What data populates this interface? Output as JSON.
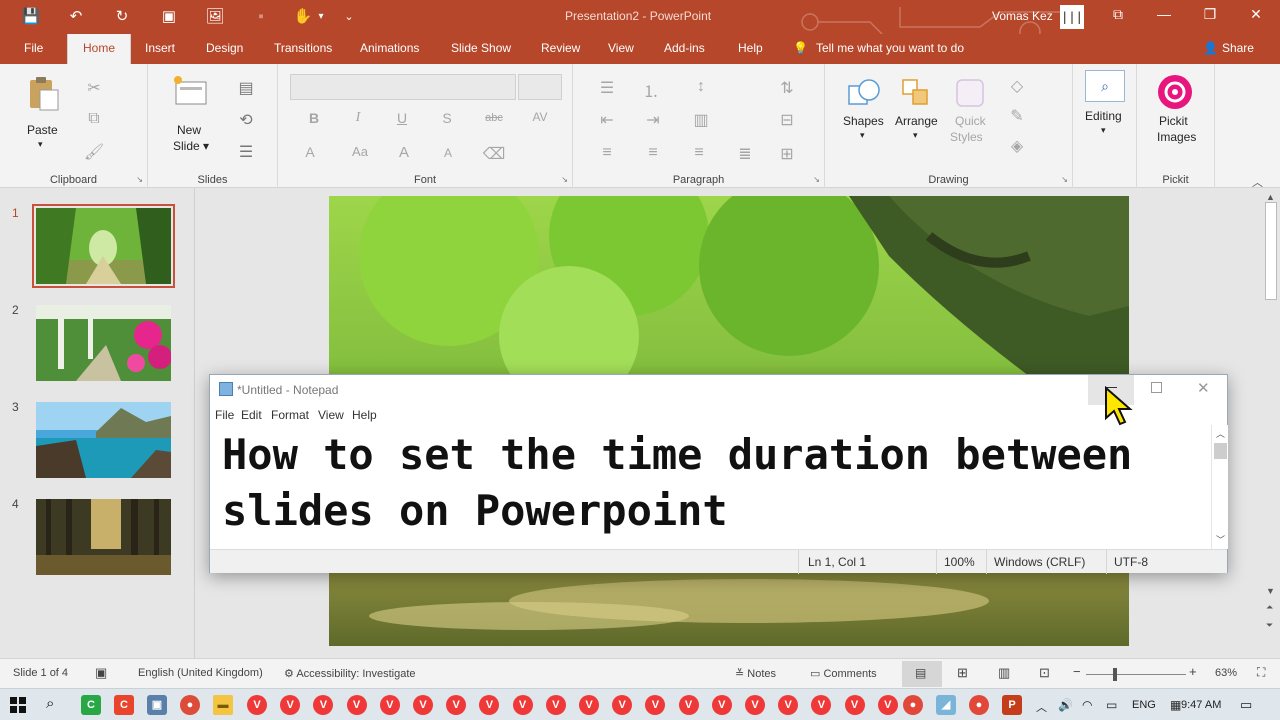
{
  "titlebar": {
    "qat": {
      "save": "💾",
      "undo": "↶",
      "redo": "↻",
      "present": "▣",
      "photo": "🖼",
      "format": "▪",
      "touch": "✋",
      "more": "⌄"
    },
    "title": "Presentation2  -  PowerPoint",
    "user": "Vomas Kez",
    "avatar_text": "|||",
    "window_controls": {
      "ribbon_options": "⧉",
      "minimize": "—",
      "maximize": "❐",
      "close": "✕"
    }
  },
  "tabs": [
    "File",
    "Home",
    "Insert",
    "Design",
    "Transitions",
    "Animations",
    "Slide Show",
    "Review",
    "View",
    "Add-ins",
    "Help"
  ],
  "active_tab": "Home",
  "tell_me": "Tell me what you want to do",
  "share": "Share",
  "ribbon": {
    "clipboard": {
      "label": "Clipboard",
      "paste": "Paste"
    },
    "slides": {
      "label": "Slides",
      "new_slide_1": "New",
      "new_slide_2": "Slide ▾"
    },
    "font": {
      "label": "Font",
      "bold": "B",
      "italic": "I",
      "underline": "U",
      "shadow": "S",
      "strike": "abc",
      "spacing": "AV",
      "color": "A",
      "case": "Aa",
      "grow": "A",
      "shrink": "A"
    },
    "paragraph": {
      "label": "Paragraph"
    },
    "drawing": {
      "label": "Drawing",
      "shapes": "Shapes",
      "arrange": "Arrange",
      "quick_styles_1": "Quick",
      "quick_styles_2": "Styles"
    },
    "editing": {
      "label": "Editing"
    },
    "pickit": {
      "label": "Pickit",
      "button_1": "Pickit",
      "button_2": "Images"
    }
  },
  "slides": [
    {
      "number": "1",
      "theme": "forest path"
    },
    {
      "number": "2",
      "theme": "garden pergola"
    },
    {
      "number": "3",
      "theme": "sea cliff"
    },
    {
      "number": "4",
      "theme": "woodland"
    }
  ],
  "notepad": {
    "title": "*Untitled - Notepad",
    "menu": [
      "File",
      "Edit",
      "Format",
      "View",
      "Help"
    ],
    "text": "How to set the time duration between\nslides on Powerpoint",
    "status": {
      "position": "Ln 1, Col 1",
      "zoom": "100%",
      "eol": "Windows (CRLF)",
      "encoding": "UTF-8"
    }
  },
  "statusbar": {
    "slide": "Slide 1 of 4",
    "language": "English (United Kingdom)",
    "accessibility": "Accessibility: Investigate",
    "notes": "Notes",
    "comments": "Comments",
    "zoom": "63%"
  },
  "taskbar": {
    "lang": "ENG",
    "time": "9:47 AM",
    "vivaldi_count": 20
  },
  "colors": {
    "accent": "#b7472a",
    "ribbon": "#f3f3f3",
    "pickit": "#e8157f"
  }
}
